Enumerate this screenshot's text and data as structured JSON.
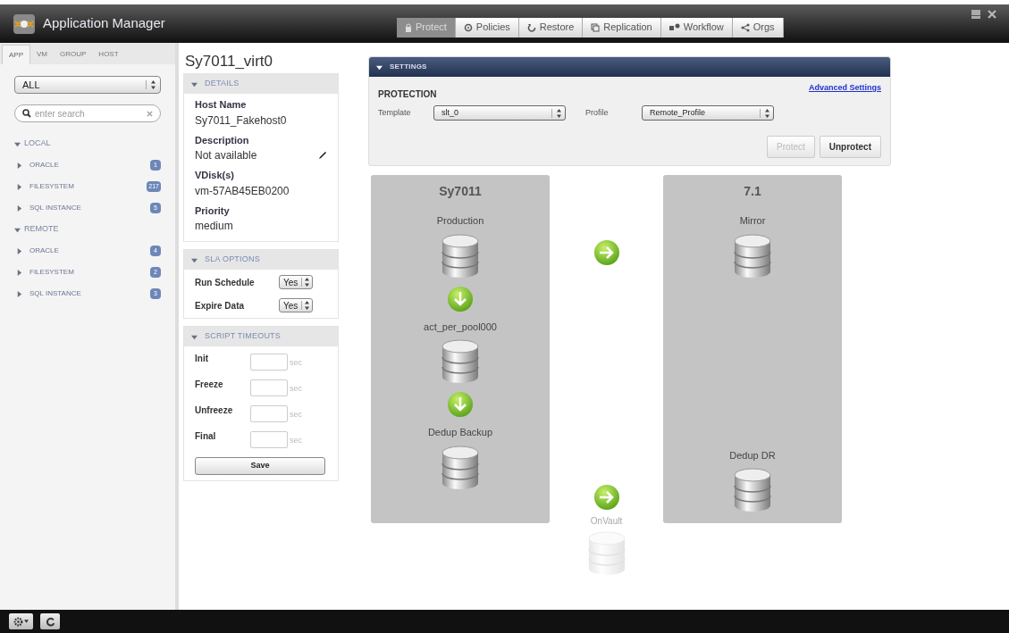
{
  "app": {
    "title": "Application Manager"
  },
  "main_tabs": [
    {
      "label": "Protect",
      "selected": true
    },
    {
      "label": "Policies",
      "selected": false
    },
    {
      "label": "Restore",
      "selected": false
    },
    {
      "label": "Replication",
      "selected": false
    },
    {
      "label": "Workflow",
      "selected": false
    },
    {
      "label": "Orgs",
      "selected": false
    }
  ],
  "sidebar": {
    "tabs": [
      {
        "label": "APP",
        "selected": true
      },
      {
        "label": "VM",
        "selected": false
      },
      {
        "label": "GROUP",
        "selected": false
      },
      {
        "label": "HOST",
        "selected": false
      }
    ],
    "filter": "ALL",
    "search": {
      "placeholder": "enter search"
    },
    "tree": [
      {
        "label": "LOCAL",
        "expanded": true,
        "children": [
          {
            "label": "ORACLE",
            "count": "1",
            "expanded": false
          },
          {
            "label": "FILESYSTEM",
            "count": "217",
            "expanded": false
          },
          {
            "label": "SQL INSTANCE",
            "count": "5",
            "expanded": false
          }
        ]
      },
      {
        "label": "REMOTE",
        "expanded": true,
        "children": [
          {
            "label": "ORACLE",
            "count": "4",
            "expanded": false
          },
          {
            "label": "FILESYSTEM",
            "count": "2",
            "expanded": false
          },
          {
            "label": "SQL INSTANCE",
            "count": "3",
            "expanded": false
          }
        ]
      }
    ]
  },
  "details": {
    "title": "Sy7011_virt0",
    "info": {
      "heading": "DETAILS",
      "expanded": true,
      "fields": [
        {
          "label": "Host Name",
          "value": "Sy7011_Fakehost0",
          "editable": false
        },
        {
          "label": "Description",
          "value": "Not available",
          "editable": true
        },
        {
          "label": "VDisk(s)",
          "value": "vm-57AB45EB0200",
          "editable": false
        },
        {
          "label": "Priority",
          "value": "medium",
          "editable": false
        }
      ]
    },
    "sla": {
      "heading": "SLA OPTIONS",
      "expanded": true,
      "rows": [
        {
          "label": "Run Schedule",
          "value": "Yes"
        },
        {
          "label": "Expire Data",
          "value": "Yes"
        }
      ]
    },
    "timeouts": {
      "heading": "SCRIPT TIMEOUTS",
      "expanded": true,
      "rows": [
        {
          "label": "Init",
          "unit": "sec"
        },
        {
          "label": "Freeze",
          "unit": "sec"
        },
        {
          "label": "Unfreeze",
          "unit": "sec"
        },
        {
          "label": "Final",
          "unit": "sec"
        }
      ],
      "save": "Save"
    }
  },
  "settings": {
    "heading": "SETTINGS",
    "expanded": true,
    "section": "PROTECTION",
    "advanced_link": "Advanced Settings",
    "template": {
      "label": "Template",
      "value": "slt_0"
    },
    "profile": {
      "label": "Profile",
      "value": "Remote_Profile"
    },
    "buttons": [
      {
        "label": "Protect",
        "disabled": true
      },
      {
        "label": "Unprotect",
        "disabled": false
      }
    ]
  },
  "diagram": {
    "panels": [
      {
        "title": "Sy7011",
        "arrows": true,
        "nodes": [
          "Production",
          "act_per_pool000",
          "Dedup Backup"
        ]
      },
      {
        "title": "7.1",
        "arrows": false,
        "nodes": [
          "Mirror",
          "Dedup DR"
        ]
      }
    ],
    "vault": {
      "label": "OnVault",
      "disabled": true
    }
  }
}
